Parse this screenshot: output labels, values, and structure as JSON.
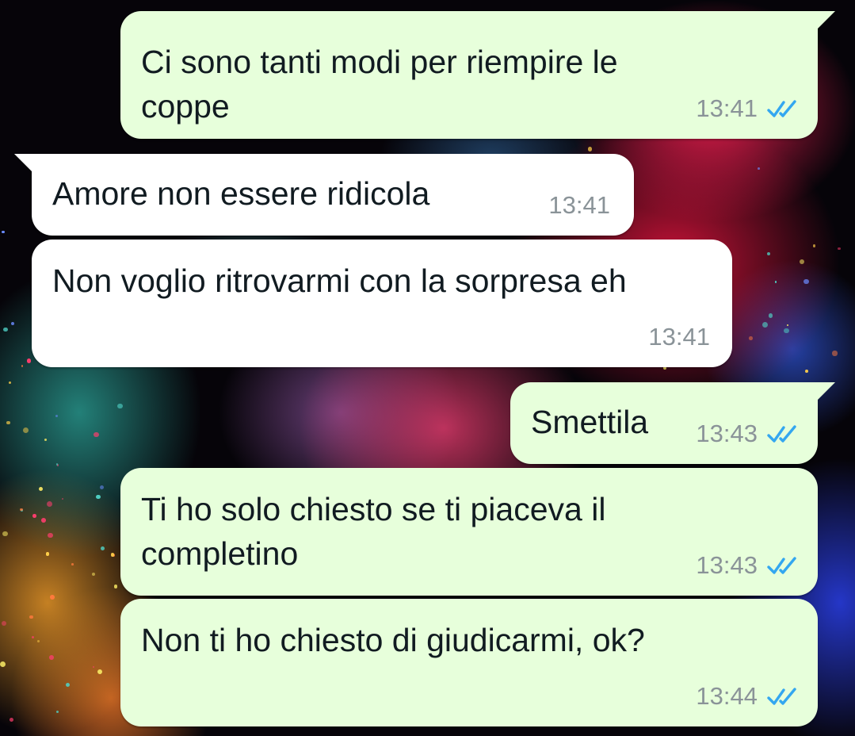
{
  "colors": {
    "outgoing_bubble": "#e7ffdb",
    "incoming_bubble": "#ffffff",
    "message_text": "#111b21",
    "timestamp_text": "#8a9398",
    "read_tick": "#34a7f0"
  },
  "messages": [
    {
      "direction": "outgoing",
      "text": "Ci sono tanti modi per riempire le coppe",
      "time": "13:41",
      "status": "read",
      "status_icon": "double-check-icon"
    },
    {
      "direction": "incoming",
      "text": "Amore non essere ridicola",
      "time": "13:41"
    },
    {
      "direction": "incoming",
      "text": "Non voglio ritrovarmi con la sorpresa eh",
      "time": "13:41"
    },
    {
      "direction": "outgoing",
      "text": "Smettila",
      "time": "13:43",
      "status": "read",
      "status_icon": "double-check-icon"
    },
    {
      "direction": "outgoing",
      "text": "Ti ho solo chiesto se ti piaceva il completino",
      "time": "13:43",
      "status": "read",
      "status_icon": "double-check-icon"
    },
    {
      "direction": "outgoing",
      "text": "Non ti ho chiesto di giudicarmi, ok?",
      "time": "13:44",
      "status": "read",
      "status_icon": "double-check-icon"
    }
  ]
}
